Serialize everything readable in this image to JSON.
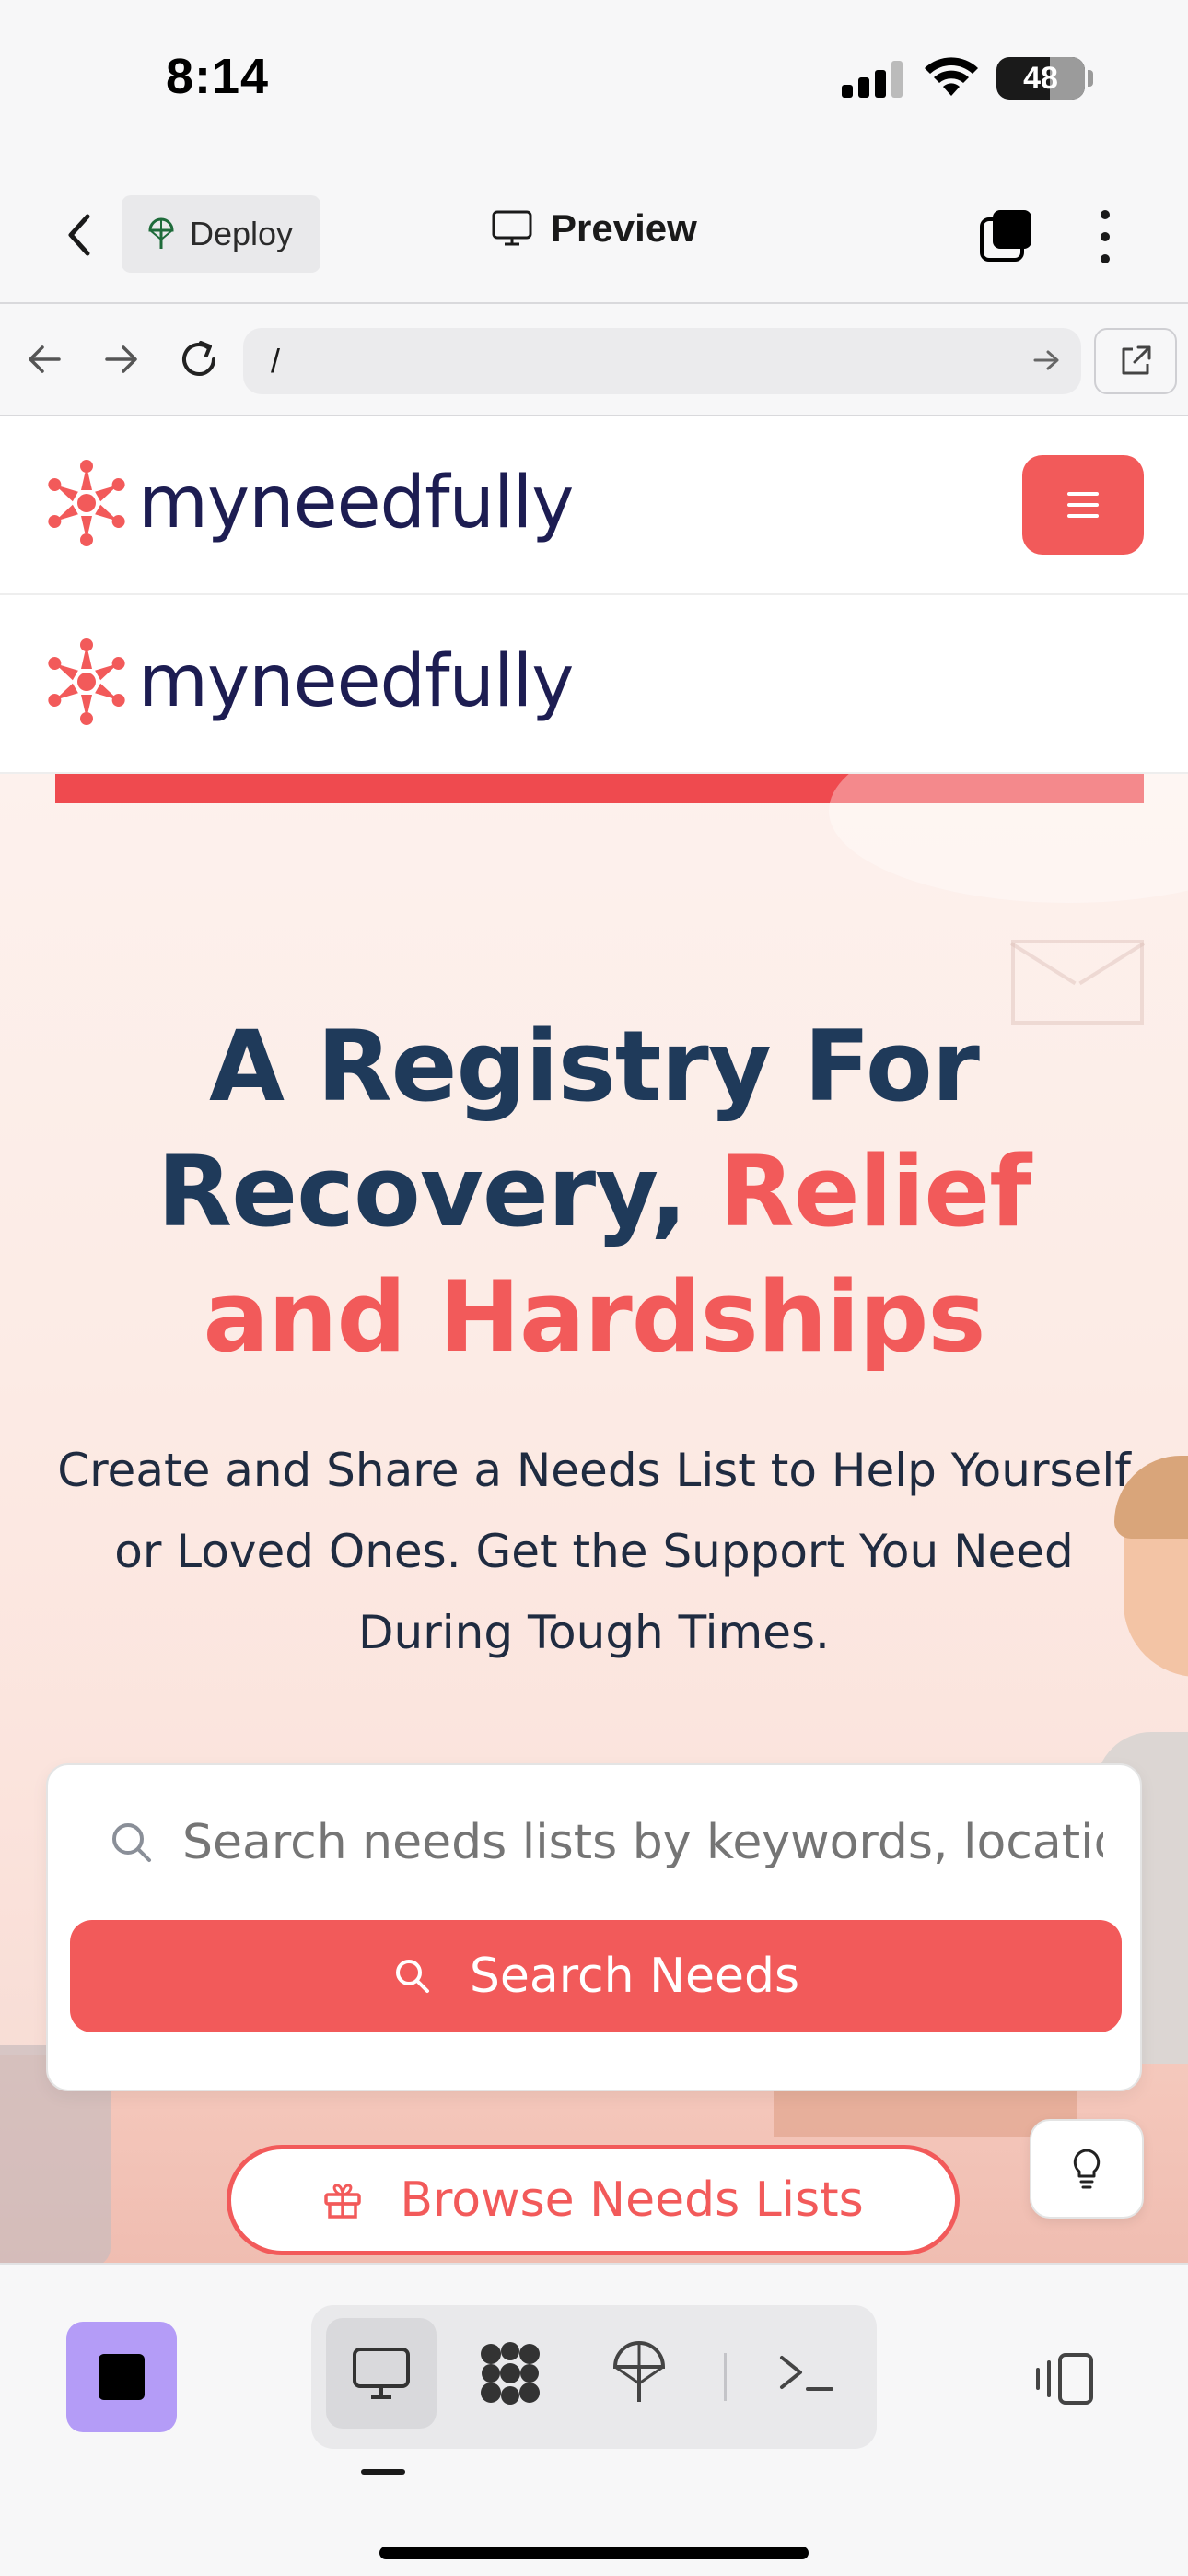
{
  "status_bar": {
    "time": "8:14",
    "battery": "48"
  },
  "app_header": {
    "deploy_label": "Deploy",
    "preview_label": "Preview"
  },
  "browser": {
    "url": "/"
  },
  "site": {
    "logo_text": "myneedfully",
    "brand_color": "#f25a5a",
    "hero": {
      "title_part1": "A Registry For Recovery,",
      "title_part2": "Relief and Hardships",
      "subtitle": "Create and Share a Needs List to Help Yourself or Loved Ones. Get the Support You Need During Tough Times."
    },
    "search": {
      "placeholder": "Search needs lists by keywords, location",
      "button_label": "Search Needs"
    },
    "browse_label": "Browse Needs Lists"
  },
  "icons": {
    "back": "chevron-left-icon",
    "deploy": "deploy-icon",
    "preview": "monitor-icon",
    "tabs": "tabs-icon",
    "more": "more-vertical-icon",
    "menu": "hamburger-icon",
    "tip": "lightbulb-icon",
    "gift": "gift-icon"
  }
}
